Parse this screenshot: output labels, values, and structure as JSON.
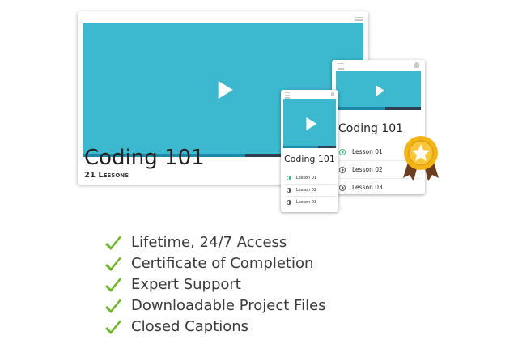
{
  "desktop": {
    "course_title": "Coding 101",
    "lessons_count": "21 Lessons",
    "progress": 0.58
  },
  "tablet": {
    "course_title": "Coding 101",
    "progress": 0.58,
    "lessons": [
      "Lesson 01",
      "Lesson 02",
      "Lesson 03"
    ]
  },
  "phone": {
    "course_title": "Coding 101",
    "progress": 0.66,
    "lessons": [
      "Lesson 01",
      "Lesson 02",
      "Lesson 03"
    ]
  },
  "features": [
    "Lifetime, 24/7 Access",
    "Certificate of Completion",
    "Expert Support",
    "Downloadable Project Files",
    "Closed Captions"
  ],
  "colors": {
    "video": "#3cb8cf",
    "progress_track": "#2c3e50",
    "progress_fill": "#1d88a8",
    "check": "#6fb52c",
    "badge": "#f3b418",
    "ribbon": "#6b3d1f"
  },
  "icons": {
    "play": "play-icon",
    "check": "checkmark-icon",
    "award": "award-badge-icon"
  }
}
